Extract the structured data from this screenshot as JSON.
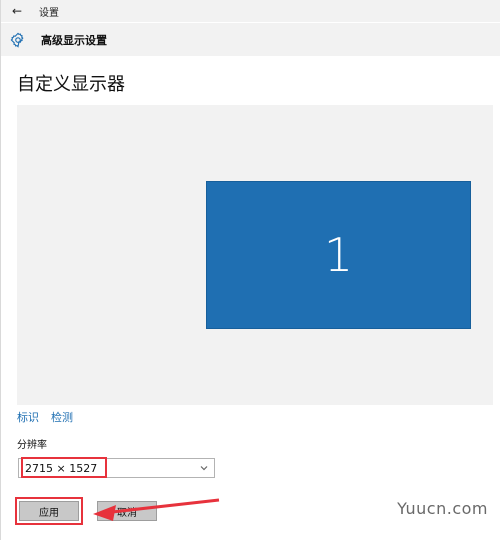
{
  "window": {
    "title": "设置"
  },
  "header": {
    "title": "高级显示设置"
  },
  "page": {
    "title": "自定义显示器"
  },
  "preview": {
    "monitor_label": "1"
  },
  "actions": {
    "identify": "标识",
    "detect": "检测"
  },
  "resolution": {
    "label": "分辨率",
    "value": "2715 × 1527"
  },
  "buttons": {
    "apply": "应用",
    "cancel": "取消"
  },
  "watermark": "Yuucn.com",
  "colors": {
    "accent": "#1f6fb2",
    "highlight": "#e7323c"
  },
  "icons": {
    "back": "back-arrow-icon",
    "settings": "gear-icon",
    "dropdown": "chevron-down-icon"
  }
}
